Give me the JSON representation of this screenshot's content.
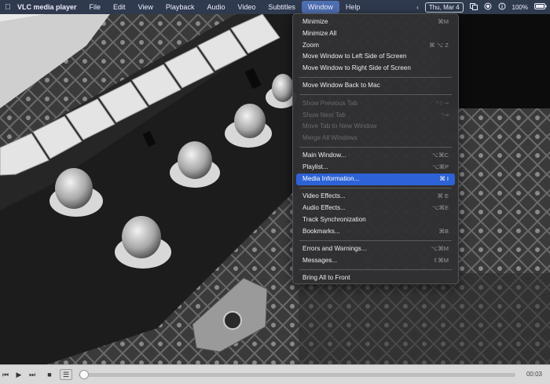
{
  "menubar": {
    "apple_icon": "apple-logo-icon",
    "app_name": "VLC media player",
    "items": [
      "File",
      "Edit",
      "View",
      "Playback",
      "Audio",
      "Video",
      "Subtitles",
      "Window",
      "Help"
    ],
    "active_item": "Window",
    "date": "Thu, Mar 4",
    "battery_percent": "100%",
    "icons": [
      "chevron-left-icon",
      "window-switch-icon",
      "record-icon",
      "info-icon",
      "battery-icon"
    ]
  },
  "window_menu": {
    "groups": [
      [
        {
          "label": "Minimize",
          "shortcut": "⌘M",
          "state": "normal"
        },
        {
          "label": "Minimize All",
          "shortcut": "",
          "state": "normal"
        },
        {
          "label": "Zoom",
          "shortcut": "⌘ ⌥ Z",
          "state": "normal"
        },
        {
          "label": "Move Window to Left Side of Screen",
          "shortcut": "",
          "state": "normal"
        },
        {
          "label": "Move Window to Right Side of Screen",
          "shortcut": "",
          "state": "normal"
        }
      ],
      [
        {
          "label": "Move Window Back to Mac",
          "shortcut": "",
          "state": "normal"
        }
      ],
      [
        {
          "label": "Show Previous Tab",
          "shortcut": "^⇧⇥",
          "state": "disabled"
        },
        {
          "label": "Show Next Tab",
          "shortcut": "^⇥",
          "state": "disabled"
        },
        {
          "label": "Move Tab to New Window",
          "shortcut": "",
          "state": "disabled"
        },
        {
          "label": "Merge All Windows",
          "shortcut": "",
          "state": "disabled"
        }
      ],
      [
        {
          "label": "Main Window...",
          "shortcut": "⌥⌘C",
          "state": "normal"
        },
        {
          "label": "Playlist...",
          "shortcut": "⌥⌘P",
          "state": "normal"
        },
        {
          "label": "Media Information...",
          "shortcut": "⌘ I",
          "state": "highlight"
        }
      ],
      [
        {
          "label": "Video Effects...",
          "shortcut": "⌘ E",
          "state": "normal"
        },
        {
          "label": "Audio Effects...",
          "shortcut": "⌥⌘E",
          "state": "normal"
        },
        {
          "label": "Track Synchronization",
          "shortcut": "",
          "state": "normal"
        },
        {
          "label": "Bookmarks...",
          "shortcut": "⌘B",
          "state": "normal"
        }
      ],
      [
        {
          "label": "Errors and Warnings...",
          "shortcut": "⌥⌘M",
          "state": "normal"
        },
        {
          "label": "Messages...",
          "shortcut": "⇧⌘M",
          "state": "normal"
        }
      ],
      [
        {
          "label": "Bring All to Front",
          "shortcut": "",
          "state": "normal"
        }
      ]
    ]
  },
  "controller": {
    "buttons": [
      {
        "name": "skip-back-button",
        "icon": "skip-back-icon",
        "glyph": "⏮"
      },
      {
        "name": "play-button",
        "icon": "play-icon",
        "glyph": "▶"
      },
      {
        "name": "skip-forward-button",
        "icon": "skip-forward-icon",
        "glyph": "⏭"
      },
      {
        "name": "stop-button",
        "icon": "stop-icon",
        "glyph": "■"
      },
      {
        "name": "playlist-toggle-button",
        "icon": "playlist-icon",
        "glyph": "☰"
      }
    ],
    "elapsed": "00:03",
    "progress": 0.0
  },
  "colors": {
    "menubar": "#2f3a4e",
    "menu_highlight": "#2d63d6",
    "menu_bg": "#303032"
  }
}
